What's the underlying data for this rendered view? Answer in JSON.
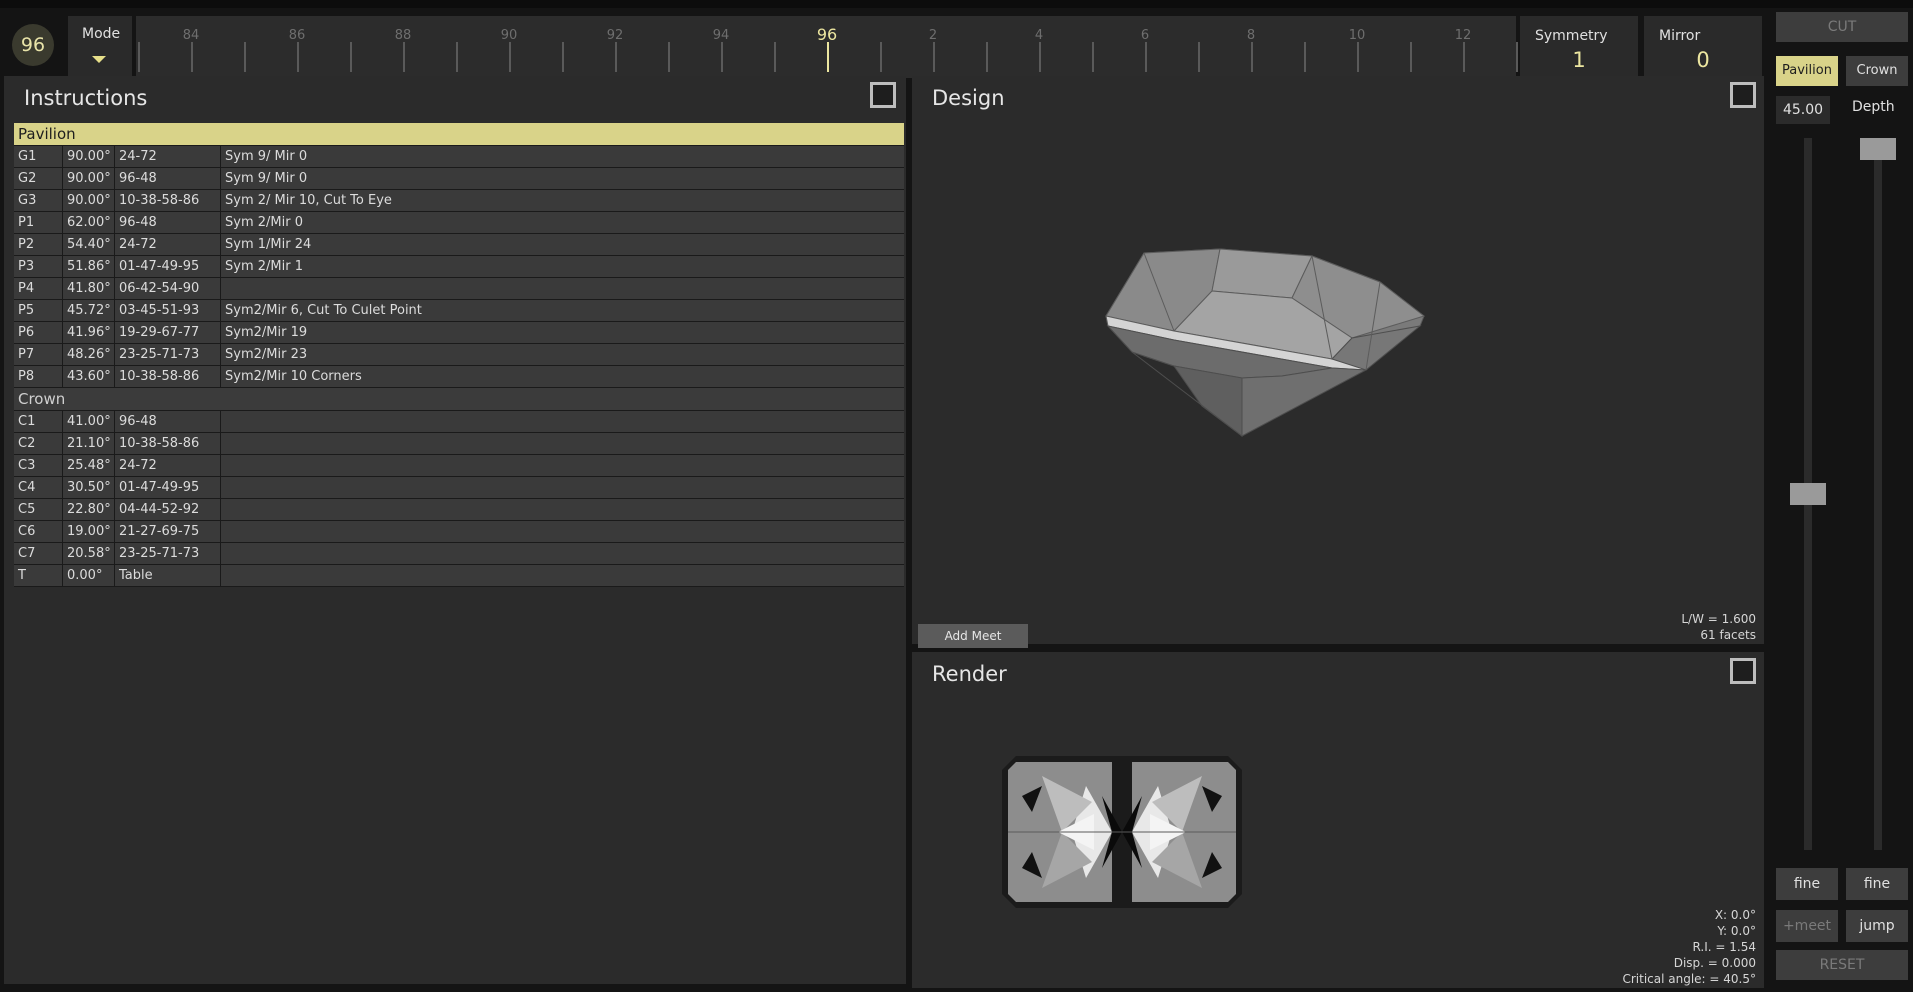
{
  "topbar": {
    "index": "96",
    "mode_label": "Mode",
    "ruler": {
      "labels": [
        "84",
        "86",
        "88",
        "90",
        "92",
        "94",
        "96",
        "2",
        "4",
        "6",
        "8",
        "10",
        "12"
      ],
      "active": "96"
    },
    "symmetry": {
      "label": "Symmetry",
      "value": "1"
    },
    "mirror": {
      "label": "Mirror",
      "value": "0"
    }
  },
  "instructions": {
    "title": "Instructions",
    "sections": [
      {
        "name": "Pavilion",
        "active": true,
        "rows": [
          [
            "G1",
            "90.00°",
            "24-72",
            "Sym 9/ Mir 0"
          ],
          [
            "G2",
            "90.00°",
            "96-48",
            "Sym 9/ Mir 0"
          ],
          [
            "G3",
            "90.00°",
            "10-38-58-86",
            "Sym 2/ Mir 10, Cut To Eye"
          ],
          [
            "P1",
            "62.00°",
            "96-48",
            "Sym 2/Mir 0"
          ],
          [
            "P2",
            "54.40°",
            "24-72",
            "Sym 1/Mir 24"
          ],
          [
            "P3",
            "51.86°",
            "01-47-49-95",
            "Sym 2/Mir 1"
          ],
          [
            "P4",
            "41.80°",
            "06-42-54-90",
            ""
          ],
          [
            "P5",
            "45.72°",
            "03-45-51-93",
            "Sym2/Mir 6, Cut To Culet Point"
          ],
          [
            "P6",
            "41.96°",
            "19-29-67-77",
            "Sym2/Mir 19"
          ],
          [
            "P7",
            "48.26°",
            "23-25-71-73",
            "Sym2/Mir 23"
          ],
          [
            "P8",
            "43.60°",
            "10-38-58-86",
            "Sym2/Mir 10 Corners"
          ]
        ]
      },
      {
        "name": "Crown",
        "active": false,
        "rows": [
          [
            "C1",
            "41.00°",
            "96-48",
            ""
          ],
          [
            "C2",
            "21.10°",
            "10-38-58-86",
            ""
          ],
          [
            "C3",
            "25.48°",
            "24-72",
            ""
          ],
          [
            "C4",
            "30.50°",
            "01-47-49-95",
            ""
          ],
          [
            "C5",
            "22.80°",
            "04-44-52-92",
            ""
          ],
          [
            "C6",
            "19.00°",
            "21-27-69-75",
            ""
          ],
          [
            "C7",
            "20.58°",
            "23-25-71-73",
            ""
          ],
          [
            "T",
            "0.00°",
            "Table",
            ""
          ]
        ]
      }
    ]
  },
  "design": {
    "title": "Design",
    "add_meet": "Add Meet",
    "lw": "L/W = 1.600",
    "facets": "61 facets"
  },
  "render": {
    "title": "Render",
    "x": "X: 0.0°",
    "y": "Y: 0.0°",
    "ri": "R.I. = 1.54",
    "disp": "Disp. = 0.000",
    "critical": "Critical angle: = 40.5°"
  },
  "sidebar": {
    "cut": "CUT",
    "pavilion": "Pavilion",
    "crown": "Crown",
    "angle": "45.00",
    "depth": "Depth",
    "fine_left": "fine",
    "fine_right": "fine",
    "meet": "+meet",
    "jump": "jump",
    "reset": "RESET",
    "angle_slider_level": 0.5,
    "depth_slider_level": 1.0
  },
  "colors": {
    "accent": "#d9d389",
    "panel": "#2b2b2b",
    "background": "#141414"
  }
}
